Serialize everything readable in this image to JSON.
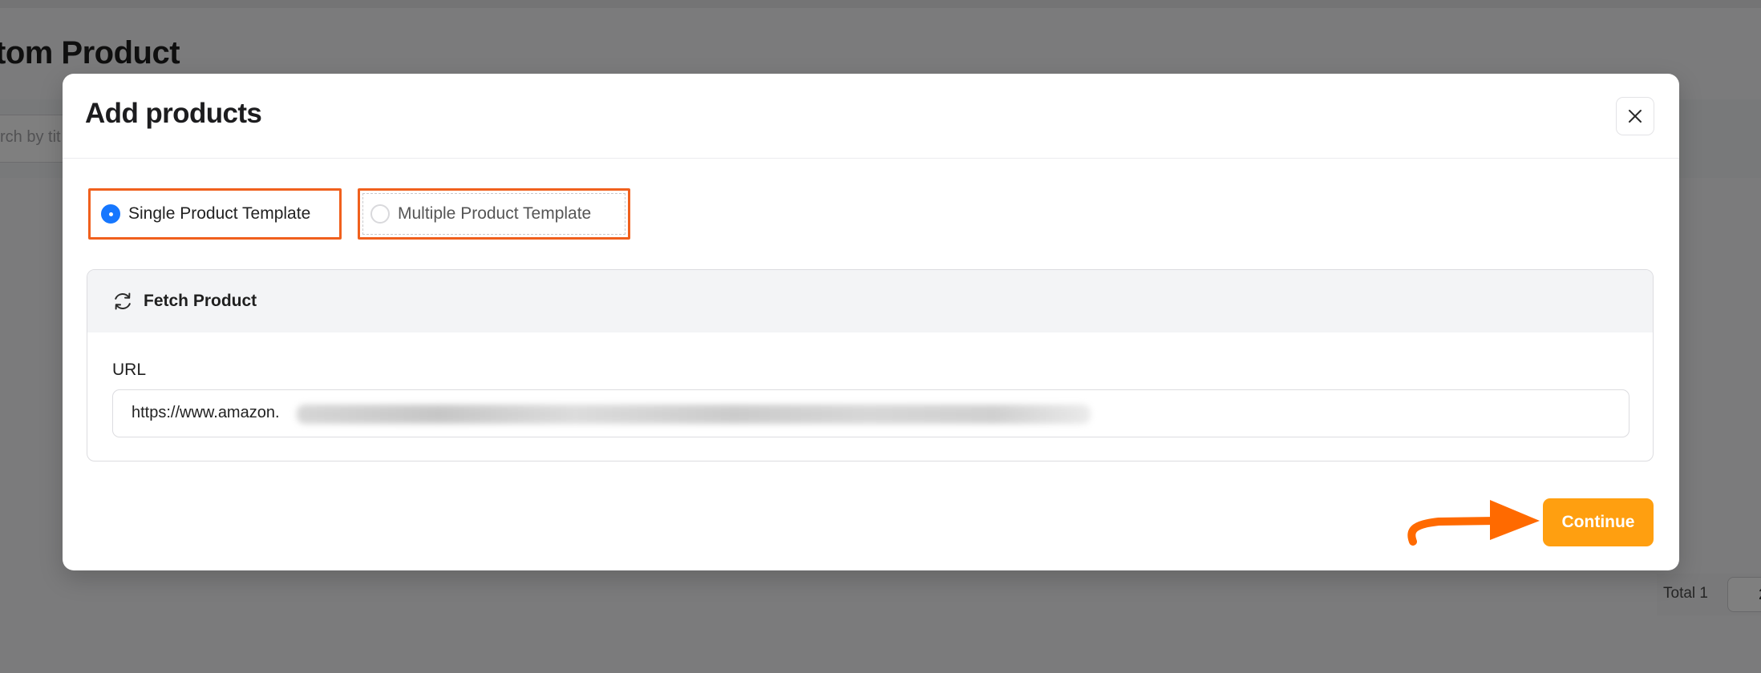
{
  "background": {
    "page_title": "tom Product",
    "search_placeholder": "rch by tit",
    "pager_total": "Total 1",
    "pager_value": "2"
  },
  "modal": {
    "title": "Add products",
    "close_icon": "close-icon",
    "template_options": [
      {
        "label": "Single Product Template",
        "selected": true
      },
      {
        "label": "Multiple Product Template",
        "selected": false
      }
    ],
    "fetch_section": {
      "title": "Fetch Product",
      "icon": "refresh-icon",
      "url_label": "URL",
      "url_value": "https://www.amazon."
    },
    "continue_label": "Continue"
  },
  "colors": {
    "highlight_orange": "#f0601d",
    "button_orange": "#ff9f10",
    "radio_blue": "#1677ff",
    "arrow_orange": "#ff6a00"
  }
}
